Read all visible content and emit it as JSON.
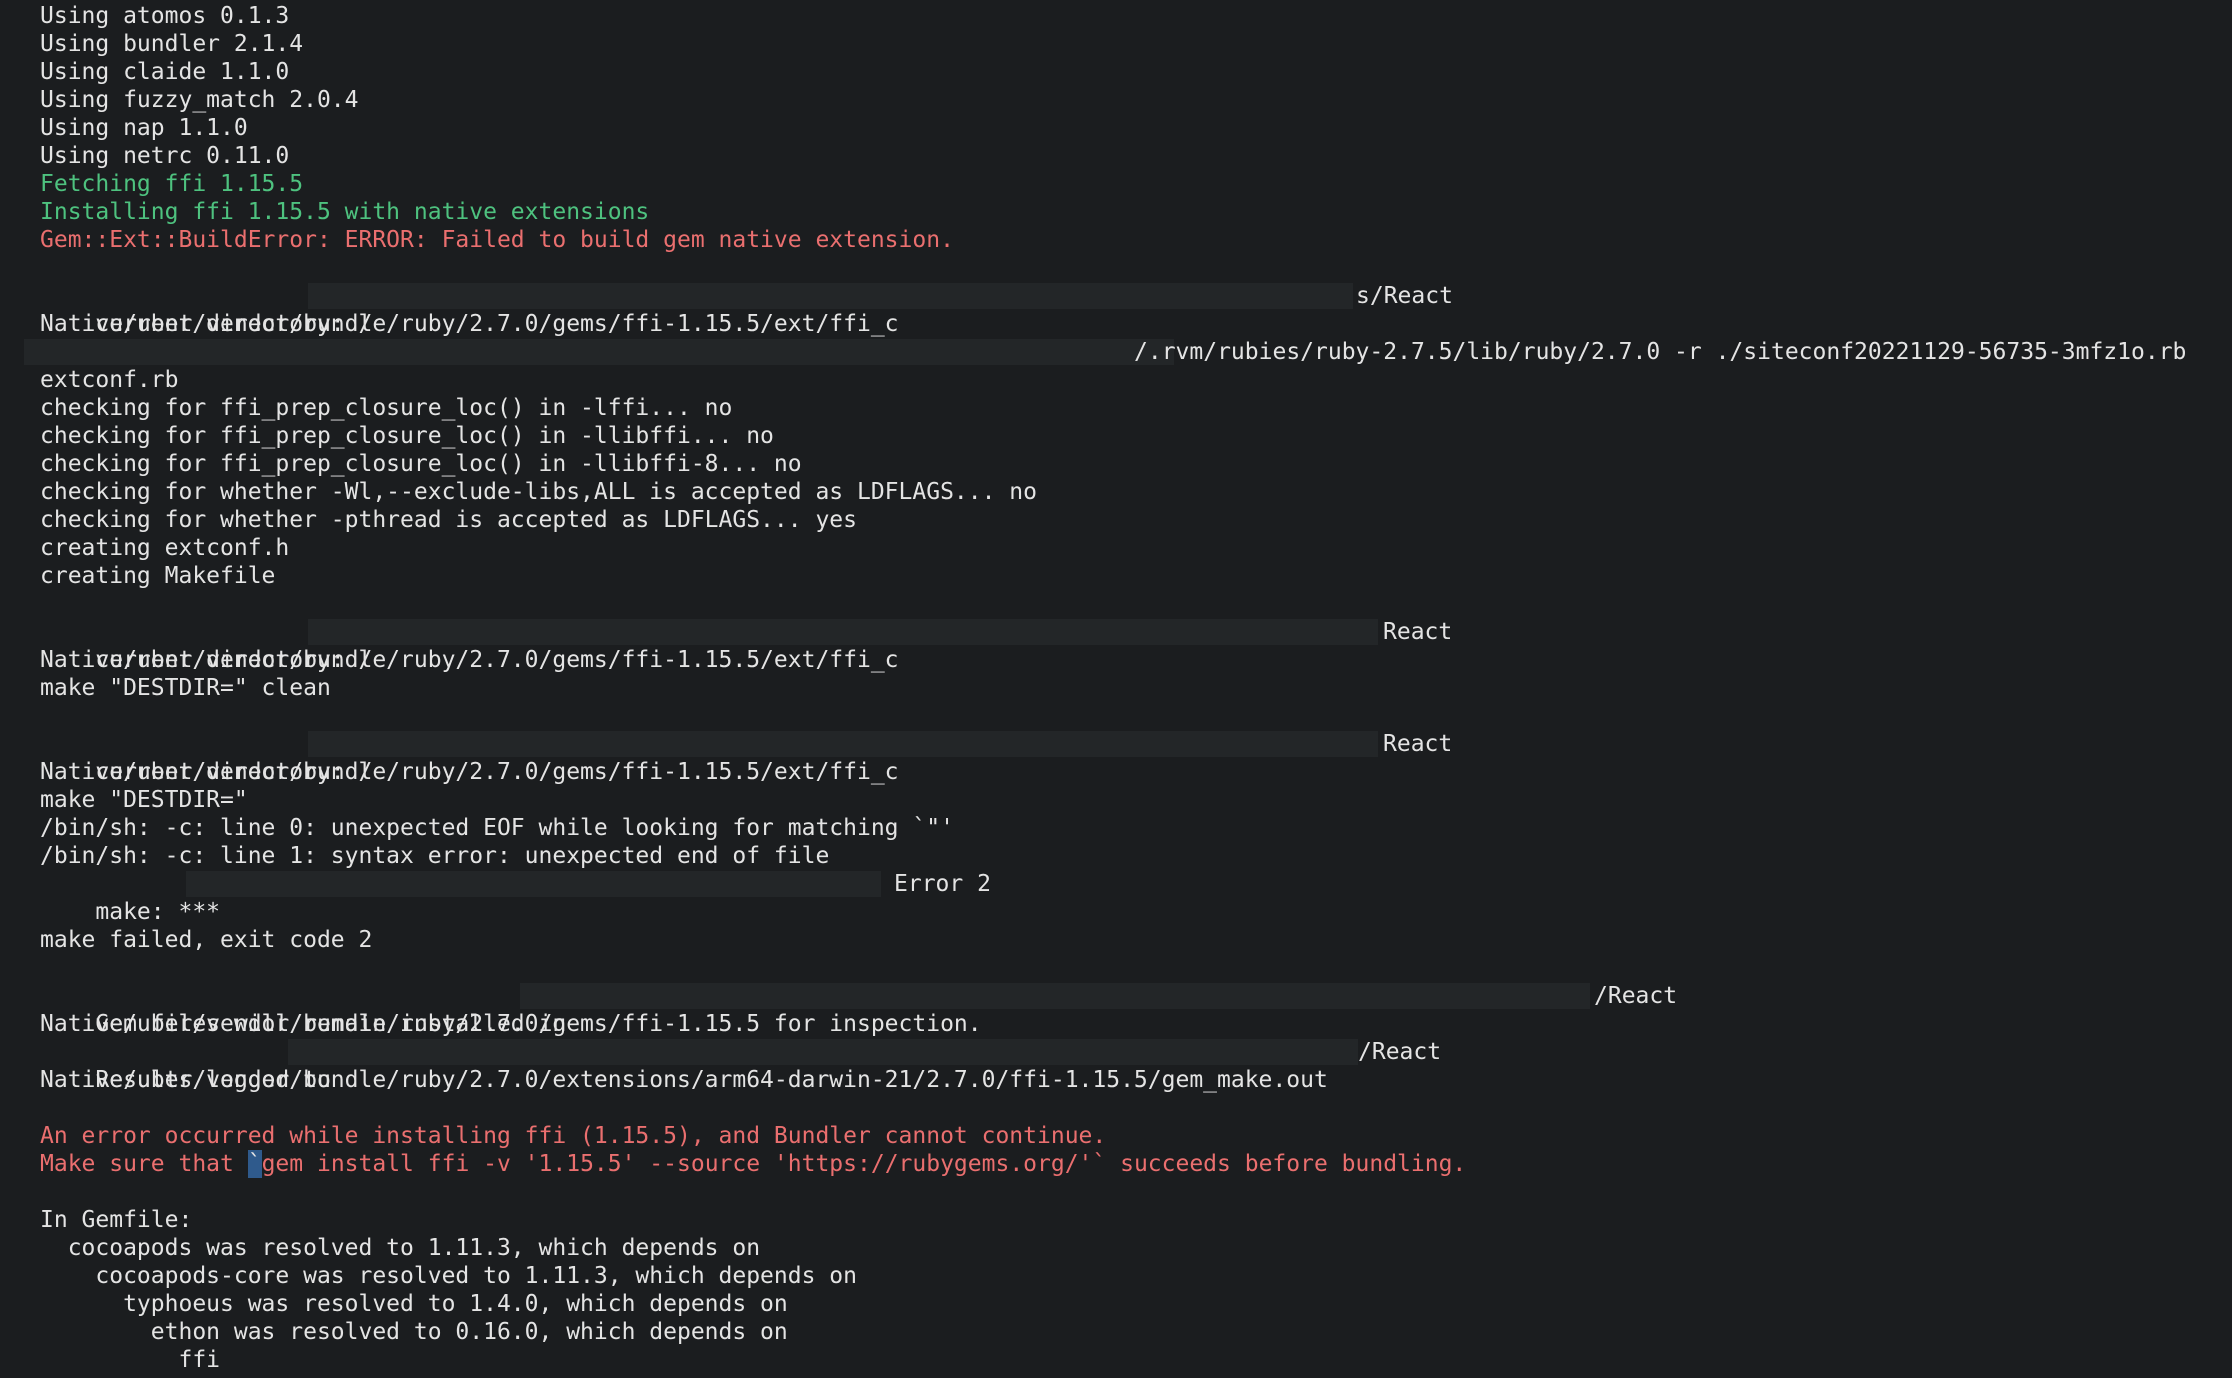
{
  "lines": {
    "l01": "Using atomos 0.1.3",
    "l02": "Using bundler 2.1.4",
    "l03": "Using claide 1.1.0",
    "l04": "Using fuzzy_match 2.0.4",
    "l05": "Using nap 1.1.0",
    "l06": "Using netrc 0.11.0",
    "l07": "Fetching ffi 1.15.5",
    "l08": "Installing ffi 1.15.5 with native extensions",
    "l09": "Gem::Ext::BuildError: ERROR: Failed to build gem native extension.",
    "l11a": "current directory: /",
    "l11b": "s/React",
    "l12": "Native/uber/vendor/bundle/ruby/2.7.0/gems/ffi-1.15.5/ext/ffi_c",
    "l13": "/.rvm/rubies/ruby-2.7.5/lib/ruby/2.7.0 -r ./siteconf20221129-56735-3mfz1o.rb",
    "l14": "extconf.rb",
    "l15": "checking for ffi_prep_closure_loc() in -lffi... no",
    "l16": "checking for ffi_prep_closure_loc() in -llibffi... no",
    "l17": "checking for ffi_prep_closure_loc() in -llibffi-8... no",
    "l18": "checking for whether -Wl,--exclude-libs,ALL is accepted as LDFLAGS... no",
    "l19": "checking for whether -pthread is accepted as LDFLAGS... yes",
    "l20": "creating extconf.h",
    "l21": "creating Makefile",
    "l23a": "current directory: /",
    "l23b": "React",
    "l24": "Native/uber/vendor/bundle/ruby/2.7.0/gems/ffi-1.15.5/ext/ffi_c",
    "l25": "make \"DESTDIR=\" clean",
    "l27a": "current directory: /",
    "l27b": "React",
    "l28": "Native/uber/vendor/bundle/ruby/2.7.0/gems/ffi-1.15.5/ext/ffi_c",
    "l29": "make \"DESTDIR=\"",
    "l30": "/bin/sh: -c: line 0: unexpected EOF while looking for matching `\"'",
    "l31": "/bin/sh: -c: line 1: syntax error: unexpected end of file",
    "l32a": "make: ***",
    "l32b": "Error 2",
    "l34": "make failed, exit code 2",
    "l36a": "Gem files will remain installed in",
    "l36b": "/React",
    "l37": "Native/uber/vendor/bundle/ruby/2.7.0/gems/ffi-1.15.5 for inspection.",
    "l38a": "Results logged to",
    "l38b": "/React",
    "l39": "Native/uber/vendor/bundle/ruby/2.7.0/extensions/arm64-darwin-21/2.7.0/ffi-1.15.5/gem_make.out",
    "l41": "An error occurred while installing ffi (1.15.5), and Bundler cannot continue.",
    "l42a": "Make sure that ",
    "l42b": "`",
    "l42c": "gem install ffi -v '1.15.5' --source 'https://rubygems.org/'` succeeds before bundling.",
    "l44": "In Gemfile:",
    "l45": "  cocoapods was resolved to 1.11.3, which depends on",
    "l46": "    cocoapods-core was resolved to 1.11.3, which depends on",
    "l47": "      typhoeus was resolved to 1.4.0, which depends on",
    "l48": "        ethon was resolved to 0.16.0, which depends on",
    "l49": "          ffi"
  },
  "colors": {
    "background": "#1b1d1f",
    "text": "#e4e4e4",
    "success": "#4ec27f",
    "error": "#ea6f6f",
    "cursor": "#2f5a8c"
  }
}
